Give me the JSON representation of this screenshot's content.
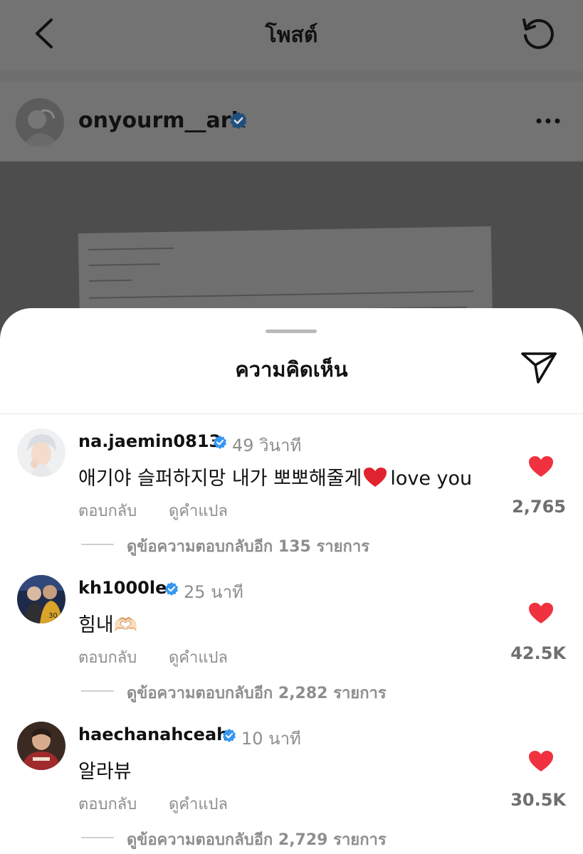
{
  "header": {
    "title": "โพสต์",
    "back_icon": "chevron-left-icon",
    "refresh_icon": "refresh-icon"
  },
  "post": {
    "author": "onyourm__ark",
    "verified": true,
    "more_icon": "more-horizontal-icon"
  },
  "comments_sheet": {
    "title": "ความคิดเห็น",
    "share_icon": "send-icon",
    "comments": [
      {
        "username": "na.jaemin0813",
        "verified": true,
        "time": "49 วินาที",
        "text": "애기야 슬퍼하지망 내가 뽀뽀해줄게",
        "text_suffix": "love you",
        "reply_label": "ตอบกลับ",
        "translate_label": "ดูคำแปล",
        "likes": "2,765",
        "view_replies": "ดูข้อความตอบกลับอีก 135 รายการ"
      },
      {
        "username": "kh1000le",
        "verified": true,
        "time": "25 นาที",
        "text": "힘내🫶🏻",
        "text_suffix": "",
        "reply_label": "ตอบกลับ",
        "translate_label": "ดูคำแปล",
        "likes": "42.5K",
        "view_replies": "ดูข้อความตอบกลับอีก 2,282 รายการ"
      },
      {
        "username": "haechanahceah",
        "verified": true,
        "time": "10 นาที",
        "text": "알라뷰",
        "text_suffix": "",
        "reply_label": "ตอบกลับ",
        "translate_label": "ดูคำแปล",
        "likes": "30.5K",
        "view_replies": "ดูข้อความตอบกลับอีก 2,729 รายการ"
      }
    ]
  },
  "colors": {
    "like_red": "#f0313f",
    "verified_blue": "#3797f0",
    "secondary_text": "#8e8e8e"
  }
}
